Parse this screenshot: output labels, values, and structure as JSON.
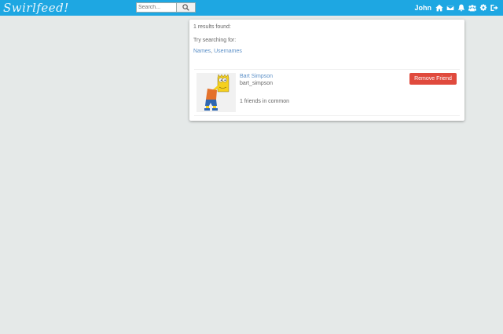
{
  "header": {
    "logo": "Swirlfeed!",
    "search": {
      "placeholder": "Search...",
      "value": ""
    },
    "user_name": "John",
    "icons": [
      "home-icon",
      "envelope-icon",
      "bell-icon",
      "users-icon",
      "gear-icon",
      "sign-out-icon"
    ],
    "bar_color": "#1ea7e2"
  },
  "results": {
    "count_text": "1 results found:",
    "try_text": "Try searching for:",
    "filters": [
      "Names",
      "Usernames"
    ],
    "filter_separator": ","
  },
  "friends": [
    {
      "name": "Bart Simpson",
      "username": "bart_simpson",
      "mutual": "1 friends in common",
      "button_label": "Remove Friend"
    }
  ],
  "colors": {
    "remove_button": "#e04a3d",
    "link": "#5b8fc7"
  }
}
